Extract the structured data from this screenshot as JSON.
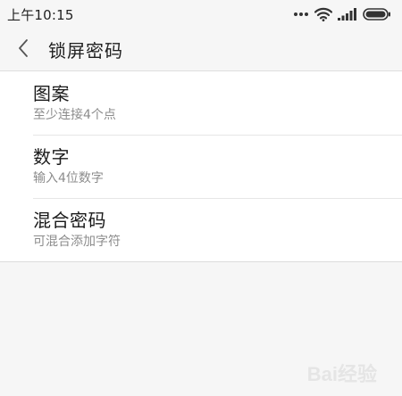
{
  "status_bar": {
    "time": "上午10:15",
    "icons": [
      "more-dots-icon",
      "wifi-icon",
      "signal-icon",
      "battery-icon"
    ]
  },
  "nav": {
    "title": "锁屏密码",
    "back_icon": "chevron-left-icon"
  },
  "options": [
    {
      "title": "图案",
      "subtitle": "至少连接4个点"
    },
    {
      "title": "数字",
      "subtitle": "输入4位数字"
    },
    {
      "title": "混合密码",
      "subtitle": "可混合添加字符"
    }
  ],
  "watermark": {
    "text": "Bai经验"
  },
  "colors": {
    "background": "#f6f6f6",
    "card": "#ffffff",
    "title_text": "#1a1a1a",
    "subtitle_text": "#8c8c8c",
    "divider": "#e6e6e6"
  }
}
